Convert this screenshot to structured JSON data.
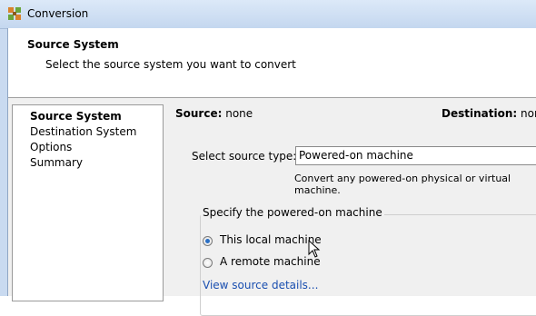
{
  "window": {
    "title": "Conversion",
    "icon": "converter-app-icon"
  },
  "header": {
    "title": "Source System",
    "subtitle": "Select the source system you want to convert"
  },
  "nav": {
    "items": [
      {
        "label": "Source System",
        "active": true
      },
      {
        "label": "Destination System",
        "active": false
      },
      {
        "label": "Options",
        "active": false
      },
      {
        "label": "Summary",
        "active": false
      }
    ]
  },
  "main": {
    "source_label": "Source:",
    "source_value": "none",
    "destination_label": "Destination:",
    "destination_value": "none",
    "source_type_label": "Select source type:",
    "source_type_value": "Powered-on machine",
    "source_type_hint": "Convert any powered-on physical or virtual machine.",
    "group_title": "Specify the powered-on machine",
    "options": [
      {
        "label": "This local machine",
        "checked": true
      },
      {
        "label": "A remote machine",
        "checked": false
      }
    ],
    "details_link": "View source details..."
  },
  "colors": {
    "link": "#1a4fb0",
    "radio_selected": "#2a6fc4",
    "titlebar": "#c9daf0"
  }
}
